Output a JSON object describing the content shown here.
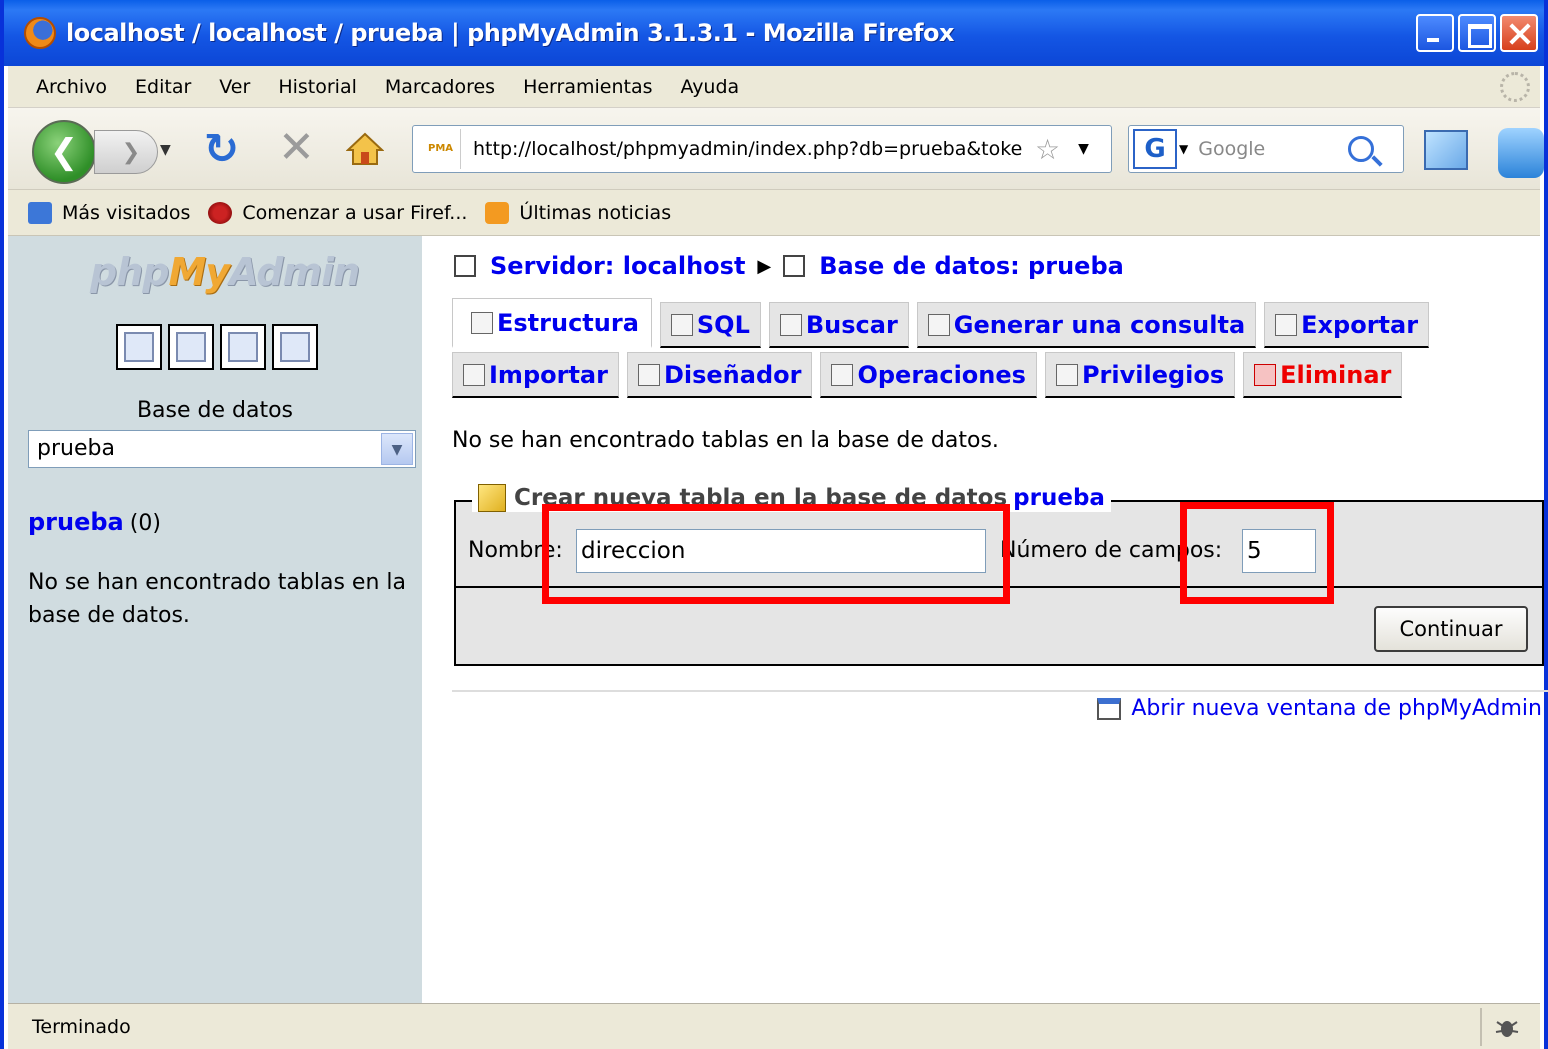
{
  "window": {
    "title": "localhost / localhost / prueba | phpMyAdmin 3.1.3.1 - Mozilla Firefox"
  },
  "menu": [
    "Archivo",
    "Editar",
    "Ver",
    "Historial",
    "Marcadores",
    "Herramientas",
    "Ayuda"
  ],
  "navbar": {
    "url": "http://localhost/phpmyadmin/index.php?db=prueba&toke",
    "url_favicon_text": "PMA",
    "search_placeholder": "Google",
    "search_engine_label": "G"
  },
  "bookmarks": [
    "Más visitados",
    "Comenzar a usar Firef...",
    "Últimas noticias"
  ],
  "left_pane": {
    "logo_prefix": "php",
    "logo_my": "My",
    "logo_suffix": "Admin",
    "db_label": "Base de datos",
    "db_selected": "prueba",
    "db_link": "prueba",
    "db_count": "(0)",
    "message": "No se han encontrado tablas en la base de datos."
  },
  "breadcrumb": {
    "server": "Servidor: localhost",
    "database": "Base de datos: prueba"
  },
  "tabs_row1": [
    "Estructura",
    "SQL",
    "Buscar",
    "Generar una consulta",
    "Exportar"
  ],
  "tabs_row2": [
    "Importar",
    "Diseñador",
    "Operaciones",
    "Privilegios",
    "Eliminar"
  ],
  "main": {
    "no_tables": "No se han encontrado tablas en la base de datos.",
    "fieldset_legend": "Crear nueva tabla en la base de datos",
    "fieldset_db": "prueba",
    "name_label": "Nombre:",
    "name_value": "direccion",
    "fields_label": "Número de campos:",
    "fields_value": "5",
    "continue_button": "Continuar",
    "new_window_link": "Abrir nueva ventana de phpMyAdmin"
  },
  "status": {
    "text": "Terminado"
  },
  "colors": {
    "link": "#0000ee",
    "danger": "#ee0000",
    "highlight": "#ff0000",
    "left_pane_bg": "#d0dce0"
  }
}
